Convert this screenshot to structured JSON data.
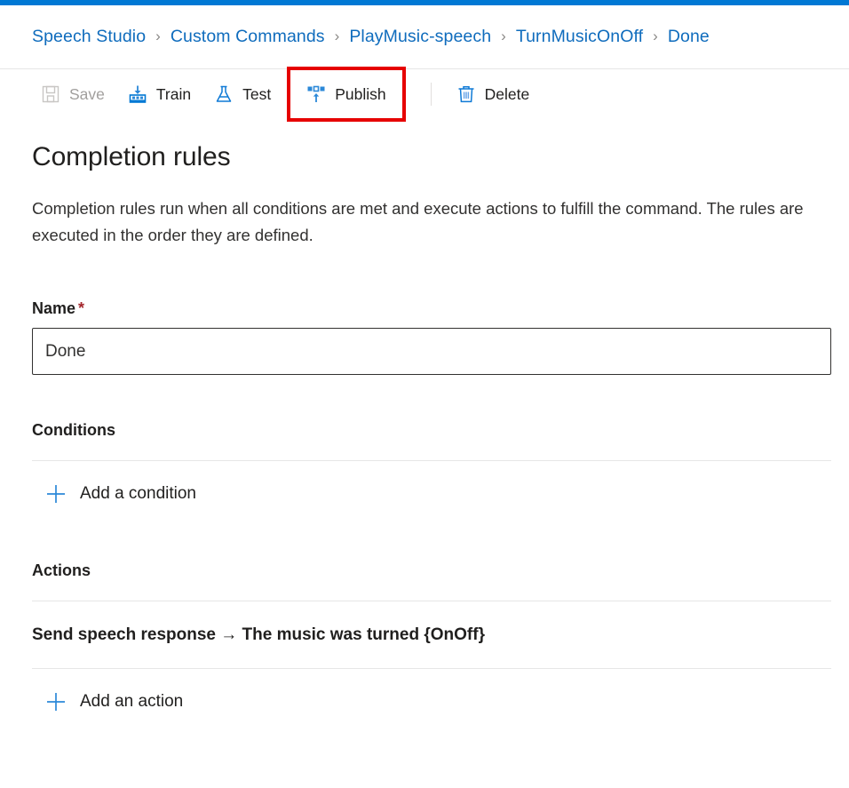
{
  "theme": {
    "accent": "#0078d4",
    "link": "#0f6cbd",
    "highlight_box": "#e60000",
    "required_star": "#a4262c",
    "text": "#201f1e",
    "divider": "#e6e6e6",
    "disabled_text": "#a19f9d"
  },
  "breadcrumb": {
    "separator": "›",
    "items": [
      {
        "label": "Speech Studio"
      },
      {
        "label": "Custom Commands"
      },
      {
        "label": "PlayMusic-speech"
      },
      {
        "label": "TurnMusicOnOff"
      },
      {
        "label": "Done"
      }
    ]
  },
  "toolbar": {
    "items": [
      {
        "label": "Save",
        "icon": "save-icon",
        "disabled": true,
        "highlighted": false
      },
      {
        "label": "Train",
        "icon": "train-icon",
        "disabled": false,
        "highlighted": false
      },
      {
        "label": "Test",
        "icon": "test-flask-icon",
        "disabled": false,
        "highlighted": false
      },
      {
        "label": "Publish",
        "icon": "publish-icon",
        "disabled": false,
        "highlighted": true
      },
      {
        "label": "Delete",
        "icon": "delete-trash-icon",
        "disabled": false,
        "highlighted": false
      }
    ]
  },
  "main": {
    "title": "Completion rules",
    "description": "Completion rules run when all conditions are met and execute actions to fulfill the command. The rules are executed in the order they are defined.",
    "name_field": {
      "label": "Name",
      "required_marker": "*",
      "value": "Done",
      "placeholder": "Name"
    },
    "conditions": {
      "title": "Conditions",
      "items": [],
      "add_label": "Add a condition",
      "add_icon": "plus-icon"
    },
    "actions": {
      "title": "Actions",
      "items": [
        {
          "label": "Send speech response → The music was turned {OnOff}"
        }
      ],
      "add_label": "Add an action",
      "add_icon": "plus-icon"
    }
  }
}
